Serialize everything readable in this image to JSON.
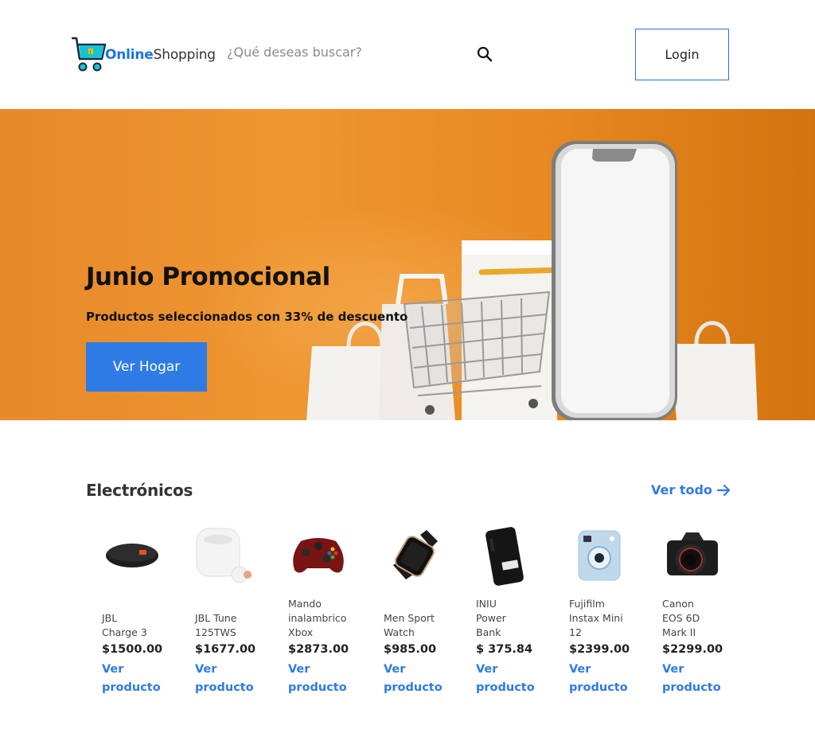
{
  "header": {
    "logo_strong": "Online",
    "logo_light": "Shopping",
    "search_placeholder": "¿Qué deseas buscar?",
    "login_label": "Login"
  },
  "hero": {
    "title": "Junio Promocional",
    "subtitle": "Productos seleccionados con 33% de descuento",
    "button_label": "Ver Hogar"
  },
  "section": {
    "title": "Electrónicos",
    "see_all_label": "Ver todo"
  },
  "products": [
    {
      "name": "JBL\nCharge 3",
      "price": "$1500.00",
      "link": "Ver producto",
      "icon": "speaker-icon"
    },
    {
      "name": "JBL Tune\n125TWS",
      "price": "$1677.00",
      "link": "Ver producto",
      "icon": "earbuds-icon"
    },
    {
      "name": "Mando\ninalambrico\nXbox",
      "price": "$2873.00",
      "link": "Ver producto",
      "icon": "gamepad-icon"
    },
    {
      "name": "Men Sport\nWatch",
      "price": "$985.00",
      "link": "Ver producto",
      "icon": "watch-icon"
    },
    {
      "name": "INIU\nPower\nBank",
      "price": "$ 375.84",
      "link": "Ver producto",
      "icon": "powerbank-icon"
    },
    {
      "name": "Fujifilm\nInstax Mini\n12",
      "price": "$2399.00",
      "link": "Ver producto",
      "icon": "instant-camera-icon"
    },
    {
      "name": "Canon\nEOS 6D\nMark II",
      "price": "$2299.00",
      "link": "Ver producto",
      "icon": "dslr-camera-icon"
    }
  ],
  "colors": {
    "accent": "#2e7be6",
    "hero_bg": "#ee9632",
    "logo_cart": "#17c3d6"
  }
}
